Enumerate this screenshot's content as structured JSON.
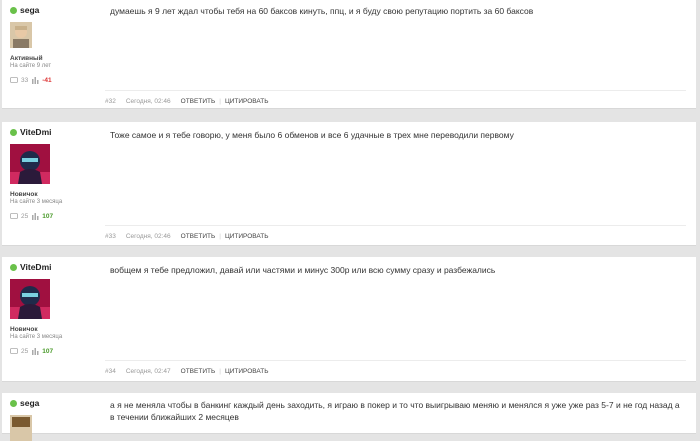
{
  "posts": [
    {
      "username": "sega",
      "rank": "Активный",
      "since": "На сайте 9 лет",
      "comments": "33",
      "rep": "-41",
      "message": "думаешь я 9 лет ждал чтобы тебя на 60 баксов кинуть, ппц, и я буду свою репутацию портить за 60 баксов",
      "number": "#32",
      "time": "Сегодня, 02:46",
      "reply": "ОТВЕТИТЬ",
      "quote": "ЦИТИРОВАТЬ"
    },
    {
      "username": "ViteDmi",
      "rank": "Новичок",
      "since": "На сайте 3 месяца",
      "comments": "25",
      "rep": "107",
      "message": "Тоже самое и я тебе говорю, у меня было 6 обменов и все 6 удачные в трех мне переводили первому",
      "number": "#33",
      "time": "Сегодня, 02:46",
      "reply": "ОТВЕТИТЬ",
      "quote": "ЦИТИРОВАТЬ"
    },
    {
      "username": "ViteDmi",
      "rank": "Новичок",
      "since": "На сайте 3 месяца",
      "comments": "25",
      "rep": "107",
      "message": "вобщем я тебе предложил, давай или частями и минус 300р или всю сумму сразу и разбежались",
      "number": "#34",
      "time": "Сегодня, 02:47",
      "reply": "ОТВЕТИТЬ",
      "quote": "ЦИТИРОВАТЬ"
    },
    {
      "username": "sega",
      "message": "а я не меняла чтобы в банкинг каждый день заходить, я играю в покер и то что выигрываю меняю и менялся я уже уже раз 5-7  и не год назад а в течении ближайших 2 месяцев"
    }
  ],
  "colors": {
    "online": "#6ac14a",
    "negative": "#d33333",
    "positive": "#4a9a2a"
  }
}
